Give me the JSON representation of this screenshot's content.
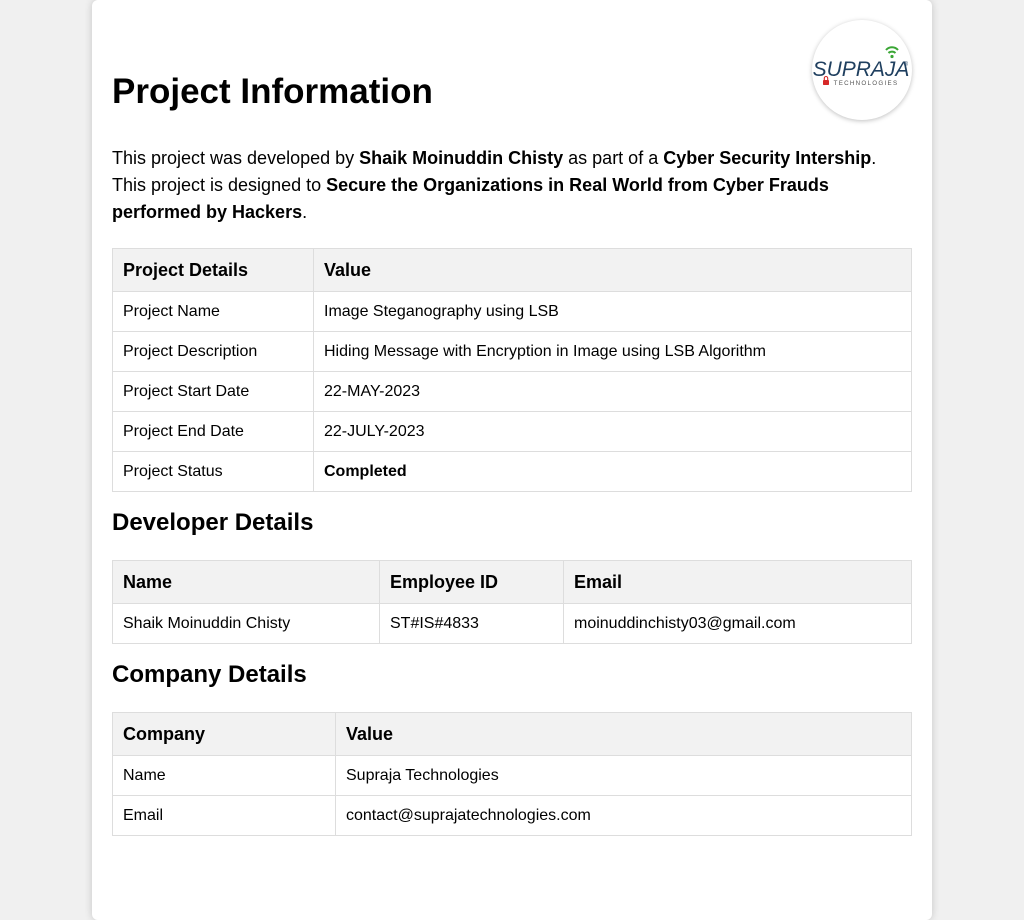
{
  "page": {
    "title": "Project Information",
    "intro": {
      "p1": "This project was developed by ",
      "developer": "Shaik Moinuddin Chisty",
      "p2": " as part of a ",
      "program": "Cyber Security Intership",
      "p3": ". This project is designed to ",
      "goal": "Secure the Organizations in Real World from Cyber Frauds performed by Hackers",
      "p4": "."
    }
  },
  "logo": {
    "wordmark": "SUPRAJA",
    "registered": "®",
    "tagline": "TECHNOLOGIES",
    "colors": {
      "text": "#1f3f5f",
      "wifi": "#3aa635",
      "lock": "#d62828"
    }
  },
  "project_table": {
    "headers": [
      "Project Details",
      "Value"
    ],
    "rows": [
      [
        "Project Name",
        "Image Steganography using LSB"
      ],
      [
        "Project Description",
        "Hiding Message with Encryption in Image using LSB Algorithm"
      ],
      [
        "Project Start Date",
        "22-MAY-2023"
      ],
      [
        "Project End Date",
        "22-JULY-2023"
      ],
      [
        "Project Status",
        "Completed"
      ]
    ]
  },
  "developer_section": {
    "heading": "Developer Details",
    "headers": [
      "Name",
      "Employee ID",
      "Email"
    ],
    "rows": [
      [
        "Shaik Moinuddin Chisty",
        "ST#IS#4833",
        "moinuddinchisty03@gmail.com"
      ]
    ]
  },
  "company_section": {
    "heading": "Company Details",
    "headers": [
      "Company",
      "Value"
    ],
    "rows": [
      [
        "Name",
        "Supraja Technologies"
      ],
      [
        "Email",
        "contact@suprajatechnologies.com"
      ]
    ]
  }
}
